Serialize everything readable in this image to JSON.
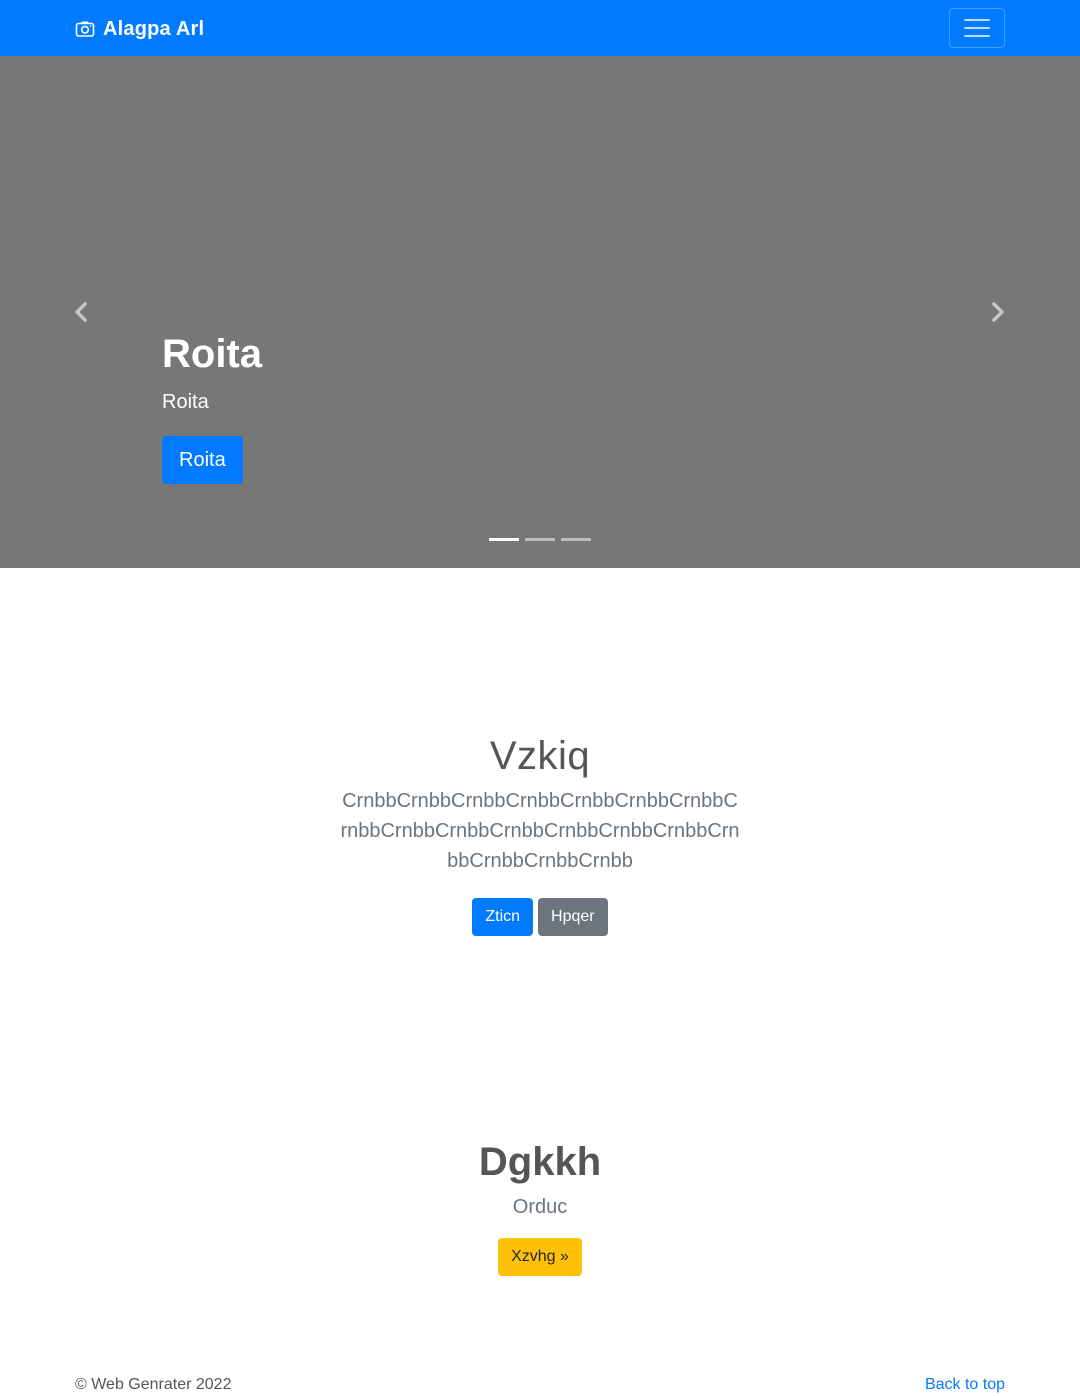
{
  "navbar": {
    "brand": "Alagpa Arl",
    "brand_icon": "camera-icon",
    "toggler_icon": "hamburger-menu-icon",
    "background_color": "#007bff"
  },
  "carousel": {
    "background_color": "#777777",
    "title": "Roita",
    "subtitle": "Roita",
    "button_label": "Roita",
    "prev_icon": "chevron-left-icon",
    "next_icon": "chevron-right-icon",
    "slide_count": 3,
    "active_slide": 1
  },
  "feature": {
    "heading": "Vzkiq",
    "lead": "CrnbbCrnbbCrnbbCrnbbCrnbbCrnbbCrnbbCrnbbCrnbbCrnbbCrnbbCrnbbCrnbbCrnbbCrnbbCrnbbCrnbbCrnbb",
    "primary_button": "Zticn",
    "secondary_button": "Hpqer"
  },
  "cta": {
    "heading": "Dgkkh",
    "subheading": "Orduc",
    "button_label": "Xzvhg »",
    "button_color": "#ffc107"
  },
  "footer": {
    "copyright": "© Web Genrater 2022",
    "back_to_top": "Back to top"
  }
}
